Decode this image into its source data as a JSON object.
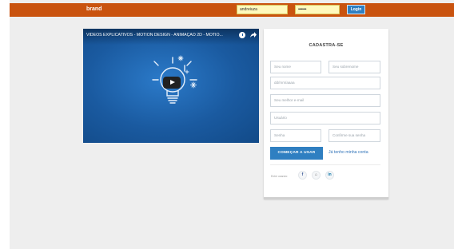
{
  "header": {
    "brand": "brand",
    "email_value": "andreiuza",
    "password_value": "••••••••",
    "login_label": "Login"
  },
  "video": {
    "title": "VÍDEOS EXPLICATIVOS - MOTION DESIGN - ANIMAÇÃO 2D - MOTIO...",
    "icons": [
      "clock-icon",
      "share-icon",
      "lightbulb-illustration",
      "play-icon"
    ]
  },
  "signup": {
    "title": "CADASTRA-SE",
    "fields": {
      "first_name_placeholder": "Seu nome",
      "last_name_placeholder": "Seu sobrenome",
      "birthdate_placeholder": "dd/mm/aaaa",
      "email_placeholder": "Seu melhor e-mail",
      "username_placeholder": "Usuário",
      "password_placeholder": "Senha",
      "confirm_password_placeholder": "Confirme sua senha"
    },
    "start_button": "COMEÇAR A USAR",
    "have_account_link": "Já tenho minha conta",
    "social_label": "Entre usando:",
    "social": {
      "facebook": "f",
      "github": "⌂",
      "linkedin": "in"
    }
  },
  "colors": {
    "topbar": "#c9530f",
    "primary": "#2f7fc1",
    "video_bg": "#1a5aa0",
    "field_highlight": "#fff9bd"
  }
}
